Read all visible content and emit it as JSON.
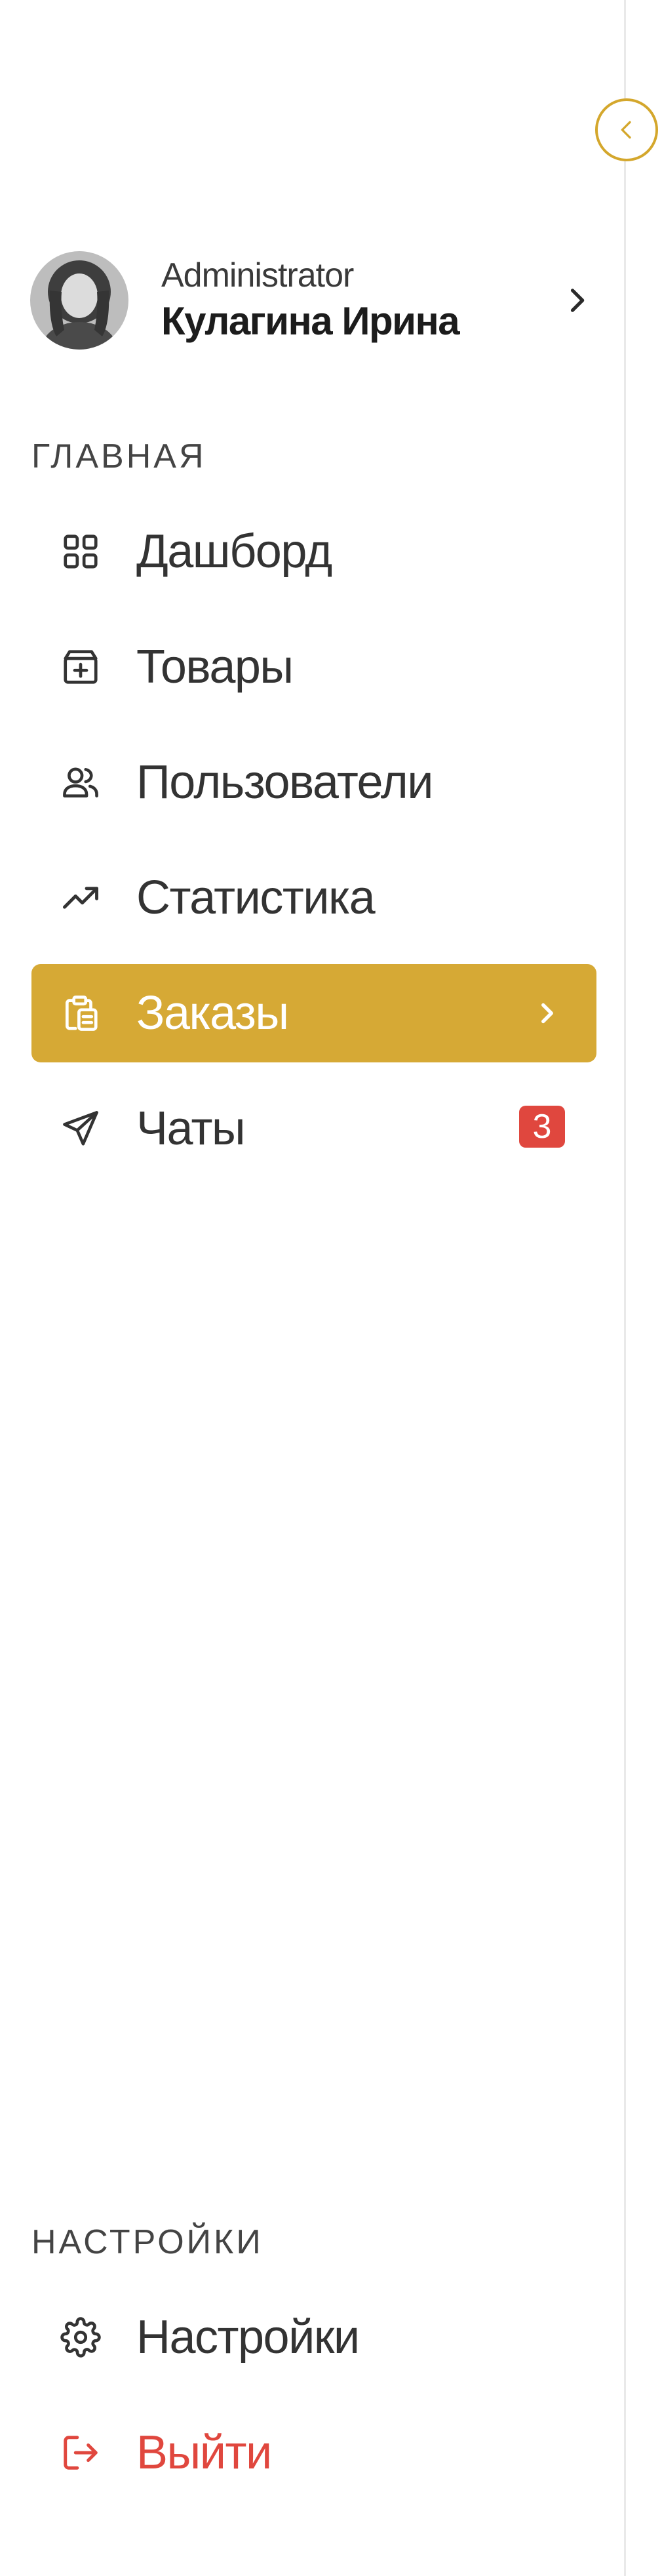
{
  "profile": {
    "role": "Administrator",
    "name": "Кулагина Ирина"
  },
  "sections": {
    "main_label": "ГЛАВНАЯ",
    "settings_label": "НАСТРОЙКИ"
  },
  "nav": {
    "dashboard": {
      "label": "Дашборд",
      "icon": "grid-icon"
    },
    "products": {
      "label": "Товары",
      "icon": "box-plus-icon"
    },
    "users": {
      "label": "Пользователи",
      "icon": "users-icon"
    },
    "statistics": {
      "label": "Статистика",
      "icon": "trending-up-icon"
    },
    "orders": {
      "label": "Заказы",
      "icon": "clipboard-icon",
      "active": true
    },
    "chats": {
      "label": "Чаты",
      "icon": "send-icon",
      "badge": "3"
    }
  },
  "settings_nav": {
    "settings": {
      "label": "Настройки",
      "icon": "gear-icon"
    },
    "logout": {
      "label": "Выйти",
      "icon": "logout-icon"
    }
  },
  "colors": {
    "accent": "#d6a935",
    "danger": "#e0473e",
    "text": "#333333",
    "border": "#e9e9e9"
  }
}
